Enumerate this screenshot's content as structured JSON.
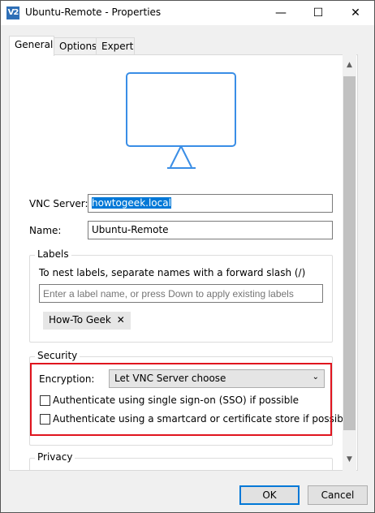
{
  "window": {
    "title": "Ubuntu-Remote - Properties",
    "app_icon_text": "V2",
    "controls": {
      "minimize": "—",
      "maximize": "☐",
      "close": "✕"
    }
  },
  "tabs": [
    {
      "label": "General",
      "active": true
    },
    {
      "label": "Options",
      "active": false
    },
    {
      "label": "Expert",
      "active": false
    }
  ],
  "general": {
    "monitor_icon": "monitor-icon",
    "vnc_server_label": "VNC Server:",
    "vnc_server_value": "howtogeek.local",
    "name_label": "Name:",
    "name_value": "Ubuntu-Remote",
    "labels": {
      "title": "Labels",
      "hint": "To nest labels, separate names with a forward slash (/)",
      "input_placeholder": "Enter a label name, or press Down to apply existing labels",
      "chips": [
        {
          "label": "How-To Geek",
          "remove": "✕"
        }
      ]
    },
    "security": {
      "title": "Security",
      "encryption_label": "Encryption:",
      "encryption_value": "Let VNC Server choose",
      "sso_label": "Authenticate using single sign-on (SSO) if possible",
      "sso_checked": false,
      "smartcard_label": "Authenticate using a smartcard or certificate store if possible",
      "smartcard_checked": false
    },
    "privacy": {
      "title": "Privacy"
    }
  },
  "footer": {
    "ok_label": "OK",
    "cancel_label": "Cancel"
  },
  "colors": {
    "accent": "#0078d7",
    "highlight_box": "#e0141e",
    "monitor_stroke": "#3a8ee6"
  }
}
